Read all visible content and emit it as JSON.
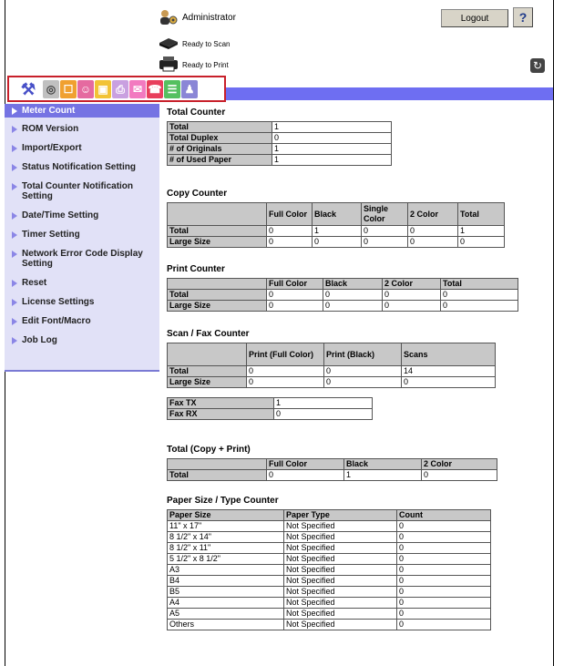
{
  "header": {
    "user": "Administrator",
    "logout_label": "Logout",
    "help_label": "?",
    "status_scan": "Ready to Scan",
    "status_print": "Ready to Print"
  },
  "toolbar": {
    "icons": [
      "settings-icon",
      "network-icon",
      "security-icon",
      "user-auth-icon",
      "box-icon",
      "print-settings-icon",
      "store-address-icon",
      "fax-icon",
      "system-icon",
      "accounts-icon"
    ]
  },
  "sidebar": {
    "items": [
      {
        "label": "Meter Count"
      },
      {
        "label": "ROM Version"
      },
      {
        "label": "Import/Export"
      },
      {
        "label": "Status Notification Setting"
      },
      {
        "label": "Total Counter Notification Setting"
      },
      {
        "label": "Date/Time Setting"
      },
      {
        "label": "Timer Setting"
      },
      {
        "label": "Network Error Code Display Setting"
      },
      {
        "label": "Reset"
      },
      {
        "label": "License Settings"
      },
      {
        "label": "Edit Font/Macro"
      },
      {
        "label": "Job Log"
      }
    ]
  },
  "total_counter": {
    "title": "Total Counter",
    "rows": [
      [
        "Total",
        "1"
      ],
      [
        "Total Duplex",
        "0"
      ],
      [
        "# of Originals",
        "1"
      ],
      [
        "# of Used Paper",
        "1"
      ]
    ]
  },
  "copy_counter": {
    "title": "Copy Counter",
    "headers": [
      "",
      "Full Color",
      "Black",
      "Single Color",
      "2 Color",
      "Total"
    ],
    "rows": [
      [
        "Total",
        "0",
        "1",
        "0",
        "0",
        "1"
      ],
      [
        "Large Size",
        "0",
        "0",
        "0",
        "0",
        "0"
      ]
    ]
  },
  "print_counter": {
    "title": "Print Counter",
    "headers": [
      "",
      "Full Color",
      "Black",
      "2 Color",
      "Total"
    ],
    "rows": [
      [
        "Total",
        "0",
        "0",
        "0",
        "0"
      ],
      [
        "Large Size",
        "0",
        "0",
        "0",
        "0"
      ]
    ]
  },
  "scan_fax": {
    "title": "Scan / Fax Counter",
    "headers": [
      "",
      "Print (Full Color)",
      "Print (Black)",
      "Scans"
    ],
    "rows": [
      [
        "Total",
        "0",
        "0",
        "14"
      ],
      [
        "Large Size",
        "0",
        "0",
        "0"
      ]
    ],
    "fax": [
      [
        "Fax TX",
        "1"
      ],
      [
        "Fax RX",
        "0"
      ]
    ]
  },
  "total_copy_print": {
    "title": "Total (Copy + Print)",
    "headers": [
      "",
      "Full Color",
      "Black",
      "2 Color"
    ],
    "rows": [
      [
        "Total",
        "0",
        "1",
        "0"
      ]
    ]
  },
  "paper": {
    "title": "Paper Size / Type Counter",
    "headers": [
      "Paper Size",
      "Paper Type",
      "Count"
    ],
    "rows": [
      [
        "11\" x 17\"",
        "Not Specified",
        "0"
      ],
      [
        "8 1/2\" x 14\"",
        "Not Specified",
        "0"
      ],
      [
        "8 1/2\" x 11\"",
        "Not Specified",
        "0"
      ],
      [
        "5 1/2\" x 8 1/2\"",
        "Not Specified",
        "0"
      ],
      [
        "A3",
        "Not Specified",
        "0"
      ],
      [
        "B4",
        "Not Specified",
        "0"
      ],
      [
        "B5",
        "Not Specified",
        "0"
      ],
      [
        "A4",
        "Not Specified",
        "0"
      ],
      [
        "A5",
        "Not Specified",
        "0"
      ],
      [
        "Others",
        "Not Specified",
        "0"
      ]
    ]
  },
  "colors": {
    "accent": "#6e6ef2",
    "sidebar_bg": "#e1e1f7",
    "active": "#7573e3",
    "highlight_border": "#c8202a"
  }
}
